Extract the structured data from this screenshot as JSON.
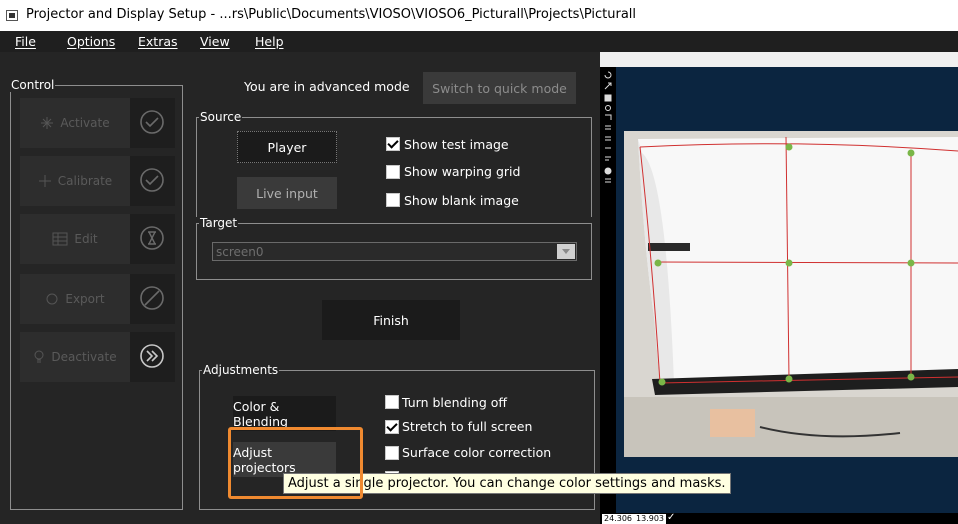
{
  "window": {
    "title": "Projector and Display Setup - ...rs\\Public\\Documents\\VIOSO\\VIOSO6_Picturall\\Projects\\Picturall"
  },
  "menu": {
    "items": [
      "File",
      "Options",
      "Extras",
      "View",
      "Help"
    ]
  },
  "control": {
    "label": "Control",
    "buttons": [
      {
        "label": "Activate",
        "icon": "check-circle-icon"
      },
      {
        "label": "Calibrate",
        "icon": "check-circle-icon"
      },
      {
        "label": "Edit",
        "icon": "hourglass-icon"
      },
      {
        "label": "Export",
        "icon": "no-entry-icon"
      },
      {
        "label": "Deactivate",
        "icon": "fast-forward-circle-icon"
      }
    ]
  },
  "mode": {
    "status_text": "You are in advanced mode",
    "switch_label": "Switch to quick mode"
  },
  "source": {
    "label": "Source",
    "player_label": "Player",
    "live_input_label": "Live input",
    "checkboxes": [
      {
        "label": "Show test image",
        "checked": true
      },
      {
        "label": "Show warping grid",
        "checked": false
      },
      {
        "label": "Show blank image",
        "checked": false
      }
    ]
  },
  "target": {
    "label": "Target",
    "selected": "screen0"
  },
  "finish_label": "Finish",
  "adjustments": {
    "label": "Adjustments",
    "color_blending_label": "Color & Blending",
    "adjust_projectors_label": "Adjust projectors",
    "checkboxes": [
      {
        "label": "Turn blending off",
        "checked": false
      },
      {
        "label": "Stretch to full screen",
        "checked": true
      },
      {
        "label": "Surface color correction",
        "checked": false
      }
    ]
  },
  "tooltip": "Adjust a single projector. You can change color settings and masks.",
  "status": {
    "x": "24.306",
    "y": "13.903"
  },
  "colors": {
    "background": "#252525",
    "highlight": "#f08a30",
    "grid_point": "#7ab648",
    "grid_line": "#d03030"
  }
}
